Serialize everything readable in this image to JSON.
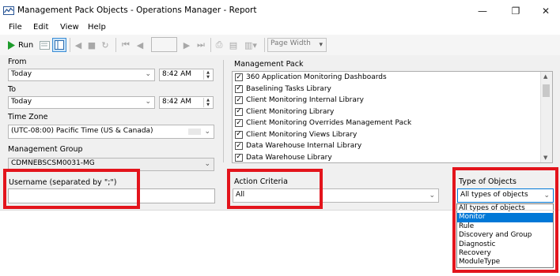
{
  "window": {
    "title": "Management Pack Objects - Operations Manager - Report",
    "minimize_glyph": "—",
    "restore_glyph": "❐",
    "close_glyph": "✕"
  },
  "menu": [
    "File",
    "Edit",
    "View",
    "Help"
  ],
  "toolbar": {
    "run_label": "Run",
    "page_zoom": "Page Width"
  },
  "params": {
    "from_label": "From",
    "from_date": "Today",
    "from_time": "8:42 AM",
    "to_label": "To",
    "to_date": "Today",
    "to_time": "8:42 AM",
    "timezone_label": "Time Zone",
    "timezone_value": "(UTC-08:00) Pacific Time (US & Canada)",
    "mgmt_group_label": "Management Group",
    "mgmt_group_value": "CDMNEBSCSM0031-MG",
    "username_label": "Username (separated by \";\")",
    "username_value": "",
    "mgmt_pack_label": "Management Pack",
    "mgmt_packs": [
      "360 Application Monitoring Dashboards",
      "Baselining Tasks Library",
      "Client Monitoring Internal Library",
      "Client Monitoring Library",
      "Client Monitoring Overrides Management Pack",
      "Client Monitoring Views Library",
      "Data Warehouse Internal Library",
      "Data Warehouse Library"
    ],
    "action_criteria_label": "Action Criteria",
    "action_criteria_value": "All",
    "type_label": "Type of Objects",
    "type_value": "All types of objects",
    "type_options": [
      "All types of objects",
      "Monitor",
      "Rule",
      "Discovery and Group",
      "Diagnostic",
      "Recovery",
      "ModuleType"
    ],
    "type_selected_index": 1
  },
  "icons": {
    "app": "report-window-icon",
    "run": "run-play-icon",
    "checkbox_mark": "✓",
    "dropdown": "chevron-down-icon"
  },
  "colors": {
    "highlight_red": "#e3141c",
    "selection_blue": "#0078d7",
    "panel_bg": "#f0f0f0"
  }
}
